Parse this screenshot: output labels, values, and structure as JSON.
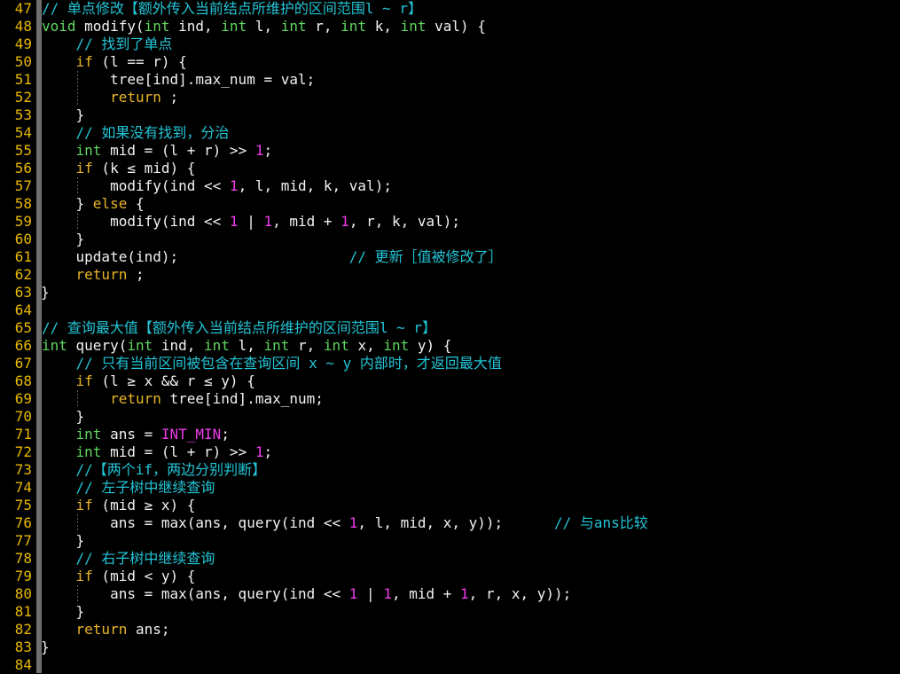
{
  "editor": {
    "theme_name": "dark-terminal",
    "background_color": "#000000",
    "gutter_bar_color": "#6e6e6e",
    "language": "cpp",
    "first_line_number": 47,
    "last_line_number": 84,
    "total_visible_lines": 38,
    "colors": {
      "line_number": "#e8b800",
      "plain_text": "#f2f2f2",
      "comment": "#22c5d6",
      "type": "#5fd75f",
      "keyword": "#e8b627",
      "number": "#ef3ced",
      "constant": "#ef3ced",
      "indent_guide": "#777777"
    },
    "lines": [
      {
        "no": "47",
        "indent_guides": 0,
        "tokens": [
          {
            "c": "comment",
            "t": "// 单点修改【额外传入当前结点所维护的区间范围l ~ r】"
          }
        ]
      },
      {
        "no": "48",
        "indent_guides": 0,
        "tokens": [
          {
            "c": "type",
            "t": "void"
          },
          {
            "c": "plain",
            "t": " modify("
          },
          {
            "c": "type",
            "t": "int"
          },
          {
            "c": "plain",
            "t": " ind, "
          },
          {
            "c": "type",
            "t": "int"
          },
          {
            "c": "plain",
            "t": " l, "
          },
          {
            "c": "type",
            "t": "int"
          },
          {
            "c": "plain",
            "t": " r, "
          },
          {
            "c": "type",
            "t": "int"
          },
          {
            "c": "plain",
            "t": " k, "
          },
          {
            "c": "type",
            "t": "int"
          },
          {
            "c": "plain",
            "t": " val) {"
          }
        ]
      },
      {
        "no": "49",
        "indent_guides": 0,
        "tokens": [
          {
            "c": "comment",
            "t": "    // 找到了单点"
          }
        ]
      },
      {
        "no": "50",
        "indent_guides": 0,
        "tokens": [
          {
            "c": "plain",
            "t": "    "
          },
          {
            "c": "keyword",
            "t": "if"
          },
          {
            "c": "plain",
            "t": " (l == r) {"
          }
        ]
      },
      {
        "no": "51",
        "indent_guides": 1,
        "tokens": [
          {
            "c": "plain",
            "t": "        tree[ind].max_num = val;"
          }
        ]
      },
      {
        "no": "52",
        "indent_guides": 1,
        "tokens": [
          {
            "c": "plain",
            "t": "        "
          },
          {
            "c": "keyword",
            "t": "return"
          },
          {
            "c": "plain",
            "t": " ;"
          }
        ]
      },
      {
        "no": "53",
        "indent_guides": 0,
        "tokens": [
          {
            "c": "plain",
            "t": "    }"
          }
        ]
      },
      {
        "no": "54",
        "indent_guides": 0,
        "tokens": [
          {
            "c": "comment",
            "t": "    // 如果没有找到，分治"
          }
        ]
      },
      {
        "no": "55",
        "indent_guides": 0,
        "tokens": [
          {
            "c": "plain",
            "t": "    "
          },
          {
            "c": "type",
            "t": "int"
          },
          {
            "c": "plain",
            "t": " mid = (l + r) >> "
          },
          {
            "c": "number",
            "t": "1"
          },
          {
            "c": "plain",
            "t": ";"
          }
        ]
      },
      {
        "no": "56",
        "indent_guides": 0,
        "tokens": [
          {
            "c": "plain",
            "t": "    "
          },
          {
            "c": "keyword",
            "t": "if"
          },
          {
            "c": "plain",
            "t": " (k ≤ mid) {"
          }
        ]
      },
      {
        "no": "57",
        "indent_guides": 1,
        "tokens": [
          {
            "c": "plain",
            "t": "        modify(ind << "
          },
          {
            "c": "number",
            "t": "1"
          },
          {
            "c": "plain",
            "t": ", l, mid, k, val);"
          }
        ]
      },
      {
        "no": "58",
        "indent_guides": 0,
        "tokens": [
          {
            "c": "plain",
            "t": "    } "
          },
          {
            "c": "keyword",
            "t": "else"
          },
          {
            "c": "plain",
            "t": " {"
          }
        ]
      },
      {
        "no": "59",
        "indent_guides": 1,
        "tokens": [
          {
            "c": "plain",
            "t": "        modify(ind << "
          },
          {
            "c": "number",
            "t": "1"
          },
          {
            "c": "plain",
            "t": " | "
          },
          {
            "c": "number",
            "t": "1"
          },
          {
            "c": "plain",
            "t": ", mid + "
          },
          {
            "c": "number",
            "t": "1"
          },
          {
            "c": "plain",
            "t": ", r, k, val);"
          }
        ]
      },
      {
        "no": "60",
        "indent_guides": 0,
        "tokens": [
          {
            "c": "plain",
            "t": "    }"
          }
        ]
      },
      {
        "no": "61",
        "indent_guides": 0,
        "tokens": [
          {
            "c": "plain",
            "t": "    update(ind);                    "
          },
          {
            "c": "comment",
            "t": "// 更新［值被修改了］"
          }
        ]
      },
      {
        "no": "62",
        "indent_guides": 0,
        "tokens": [
          {
            "c": "plain",
            "t": "    "
          },
          {
            "c": "keyword",
            "t": "return"
          },
          {
            "c": "plain",
            "t": " ;"
          }
        ]
      },
      {
        "no": "63",
        "indent_guides": 0,
        "overhang": true,
        "tokens": [
          {
            "c": "plain",
            "t": "}"
          }
        ]
      },
      {
        "no": "64",
        "indent_guides": 0,
        "tokens": []
      },
      {
        "no": "65",
        "indent_guides": 0,
        "tokens": [
          {
            "c": "comment",
            "t": "// 查询最大值【额外传入当前结点所维护的区间范围l ~ r】"
          }
        ]
      },
      {
        "no": "66",
        "indent_guides": 0,
        "tokens": [
          {
            "c": "type",
            "t": "int"
          },
          {
            "c": "plain",
            "t": " query("
          },
          {
            "c": "type",
            "t": "int"
          },
          {
            "c": "plain",
            "t": " ind, "
          },
          {
            "c": "type",
            "t": "int"
          },
          {
            "c": "plain",
            "t": " l, "
          },
          {
            "c": "type",
            "t": "int"
          },
          {
            "c": "plain",
            "t": " r, "
          },
          {
            "c": "type",
            "t": "int"
          },
          {
            "c": "plain",
            "t": " x, "
          },
          {
            "c": "type",
            "t": "int"
          },
          {
            "c": "plain",
            "t": " y) {"
          }
        ]
      },
      {
        "no": "67",
        "indent_guides": 0,
        "tokens": [
          {
            "c": "comment",
            "t": "    // 只有当前区间被包含在查询区间 x ~ y 内部时，才返回最大值"
          }
        ]
      },
      {
        "no": "68",
        "indent_guides": 0,
        "tokens": [
          {
            "c": "plain",
            "t": "    "
          },
          {
            "c": "keyword",
            "t": "if"
          },
          {
            "c": "plain",
            "t": " (l ≥ x && r ≤ y) {"
          }
        ]
      },
      {
        "no": "69",
        "indent_guides": 1,
        "tokens": [
          {
            "c": "plain",
            "t": "        "
          },
          {
            "c": "keyword",
            "t": "return"
          },
          {
            "c": "plain",
            "t": " tree[ind].max_num;"
          }
        ]
      },
      {
        "no": "70",
        "indent_guides": 0,
        "tokens": [
          {
            "c": "plain",
            "t": "    }"
          }
        ]
      },
      {
        "no": "71",
        "indent_guides": 0,
        "tokens": [
          {
            "c": "plain",
            "t": "    "
          },
          {
            "c": "type",
            "t": "int"
          },
          {
            "c": "plain",
            "t": " ans = "
          },
          {
            "c": "const",
            "t": "INT_MIN"
          },
          {
            "c": "plain",
            "t": ";"
          }
        ]
      },
      {
        "no": "72",
        "indent_guides": 0,
        "tokens": [
          {
            "c": "plain",
            "t": "    "
          },
          {
            "c": "type",
            "t": "int"
          },
          {
            "c": "plain",
            "t": " mid = (l + r) >> "
          },
          {
            "c": "number",
            "t": "1"
          },
          {
            "c": "plain",
            "t": ";"
          }
        ]
      },
      {
        "no": "73",
        "indent_guides": 0,
        "tokens": [
          {
            "c": "comment",
            "t": "    //【两个if，两边分别判断】"
          }
        ]
      },
      {
        "no": "74",
        "indent_guides": 0,
        "tokens": [
          {
            "c": "comment",
            "t": "    // 左子树中继续查询"
          }
        ]
      },
      {
        "no": "75",
        "indent_guides": 0,
        "tokens": [
          {
            "c": "plain",
            "t": "    "
          },
          {
            "c": "keyword",
            "t": "if"
          },
          {
            "c": "plain",
            "t": " (mid ≥ x) {"
          }
        ]
      },
      {
        "no": "76",
        "indent_guides": 1,
        "tokens": [
          {
            "c": "plain",
            "t": "        ans = max(ans, query(ind << "
          },
          {
            "c": "number",
            "t": "1"
          },
          {
            "c": "plain",
            "t": ", l, mid, x, y));      "
          },
          {
            "c": "comment",
            "t": "// 与ans比较"
          }
        ]
      },
      {
        "no": "77",
        "indent_guides": 0,
        "tokens": [
          {
            "c": "plain",
            "t": "    }"
          }
        ]
      },
      {
        "no": "78",
        "indent_guides": 0,
        "tokens": [
          {
            "c": "comment",
            "t": "    // 右子树中继续查询"
          }
        ]
      },
      {
        "no": "79",
        "indent_guides": 0,
        "tokens": [
          {
            "c": "plain",
            "t": "    "
          },
          {
            "c": "keyword",
            "t": "if"
          },
          {
            "c": "plain",
            "t": " (mid < y) {"
          }
        ]
      },
      {
        "no": "80",
        "indent_guides": 1,
        "tokens": [
          {
            "c": "plain",
            "t": "        ans = max(ans, query(ind << "
          },
          {
            "c": "number",
            "t": "1"
          },
          {
            "c": "plain",
            "t": " | "
          },
          {
            "c": "number",
            "t": "1"
          },
          {
            "c": "plain",
            "t": ", mid + "
          },
          {
            "c": "number",
            "t": "1"
          },
          {
            "c": "plain",
            "t": ", r, x, y));"
          }
        ]
      },
      {
        "no": "81",
        "indent_guides": 0,
        "tokens": [
          {
            "c": "plain",
            "t": "    }"
          }
        ]
      },
      {
        "no": "82",
        "indent_guides": 0,
        "tokens": [
          {
            "c": "plain",
            "t": "    "
          },
          {
            "c": "keyword",
            "t": "return"
          },
          {
            "c": "plain",
            "t": " ans;"
          }
        ]
      },
      {
        "no": "83",
        "indent_guides": 0,
        "overhang": true,
        "tokens": [
          {
            "c": "plain",
            "t": "}"
          }
        ]
      },
      {
        "no": "84",
        "indent_guides": 0,
        "tokens": []
      }
    ]
  }
}
